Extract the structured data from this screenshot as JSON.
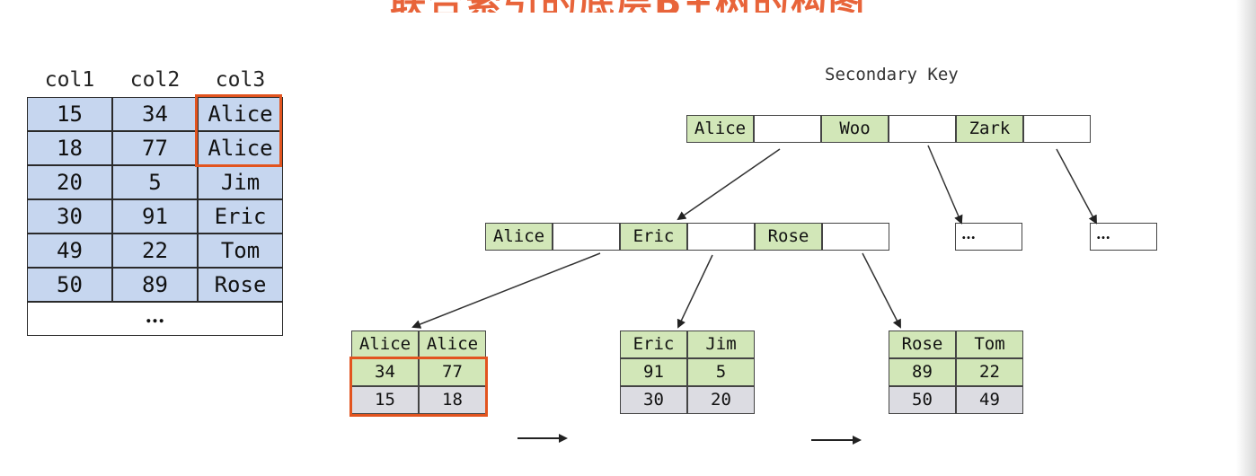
{
  "title": "联合索引的底层B+树的构图",
  "table": {
    "headers": [
      "col1",
      "col2",
      "col3"
    ],
    "rows": [
      [
        "15",
        "34",
        "Alice"
      ],
      [
        "18",
        "77",
        "Alice"
      ],
      [
        "20",
        "5",
        "Jim"
      ],
      [
        "30",
        "91",
        "Eric"
      ],
      [
        "49",
        "22",
        "Tom"
      ],
      [
        "50",
        "89",
        "Rose"
      ]
    ],
    "more": "…"
  },
  "tree": {
    "label": "Secondary Key",
    "root": [
      "Alice",
      "Woo",
      "Zark"
    ],
    "middle": [
      "Alice",
      "Eric",
      "Rose"
    ],
    "more_nodes": [
      "…",
      "…"
    ],
    "leaves": [
      {
        "keys": [
          "Alice",
          "Alice"
        ],
        "col2": [
          "34",
          "77"
        ],
        "col1": [
          "15",
          "18"
        ]
      },
      {
        "keys": [
          "Eric",
          "Jim"
        ],
        "col2": [
          "91",
          "5"
        ],
        "col1": [
          "30",
          "20"
        ]
      },
      {
        "keys": [
          "Rose",
          "Tom"
        ],
        "col2": [
          "89",
          "22"
        ],
        "col1": [
          "50",
          "49"
        ]
      }
    ]
  },
  "colors": {
    "table_fill": "#c6d6ef",
    "key_fill": "#d2e7b8",
    "pk_fill": "#dcdce2",
    "highlight": "#e2541f",
    "title": "#e8643a"
  }
}
